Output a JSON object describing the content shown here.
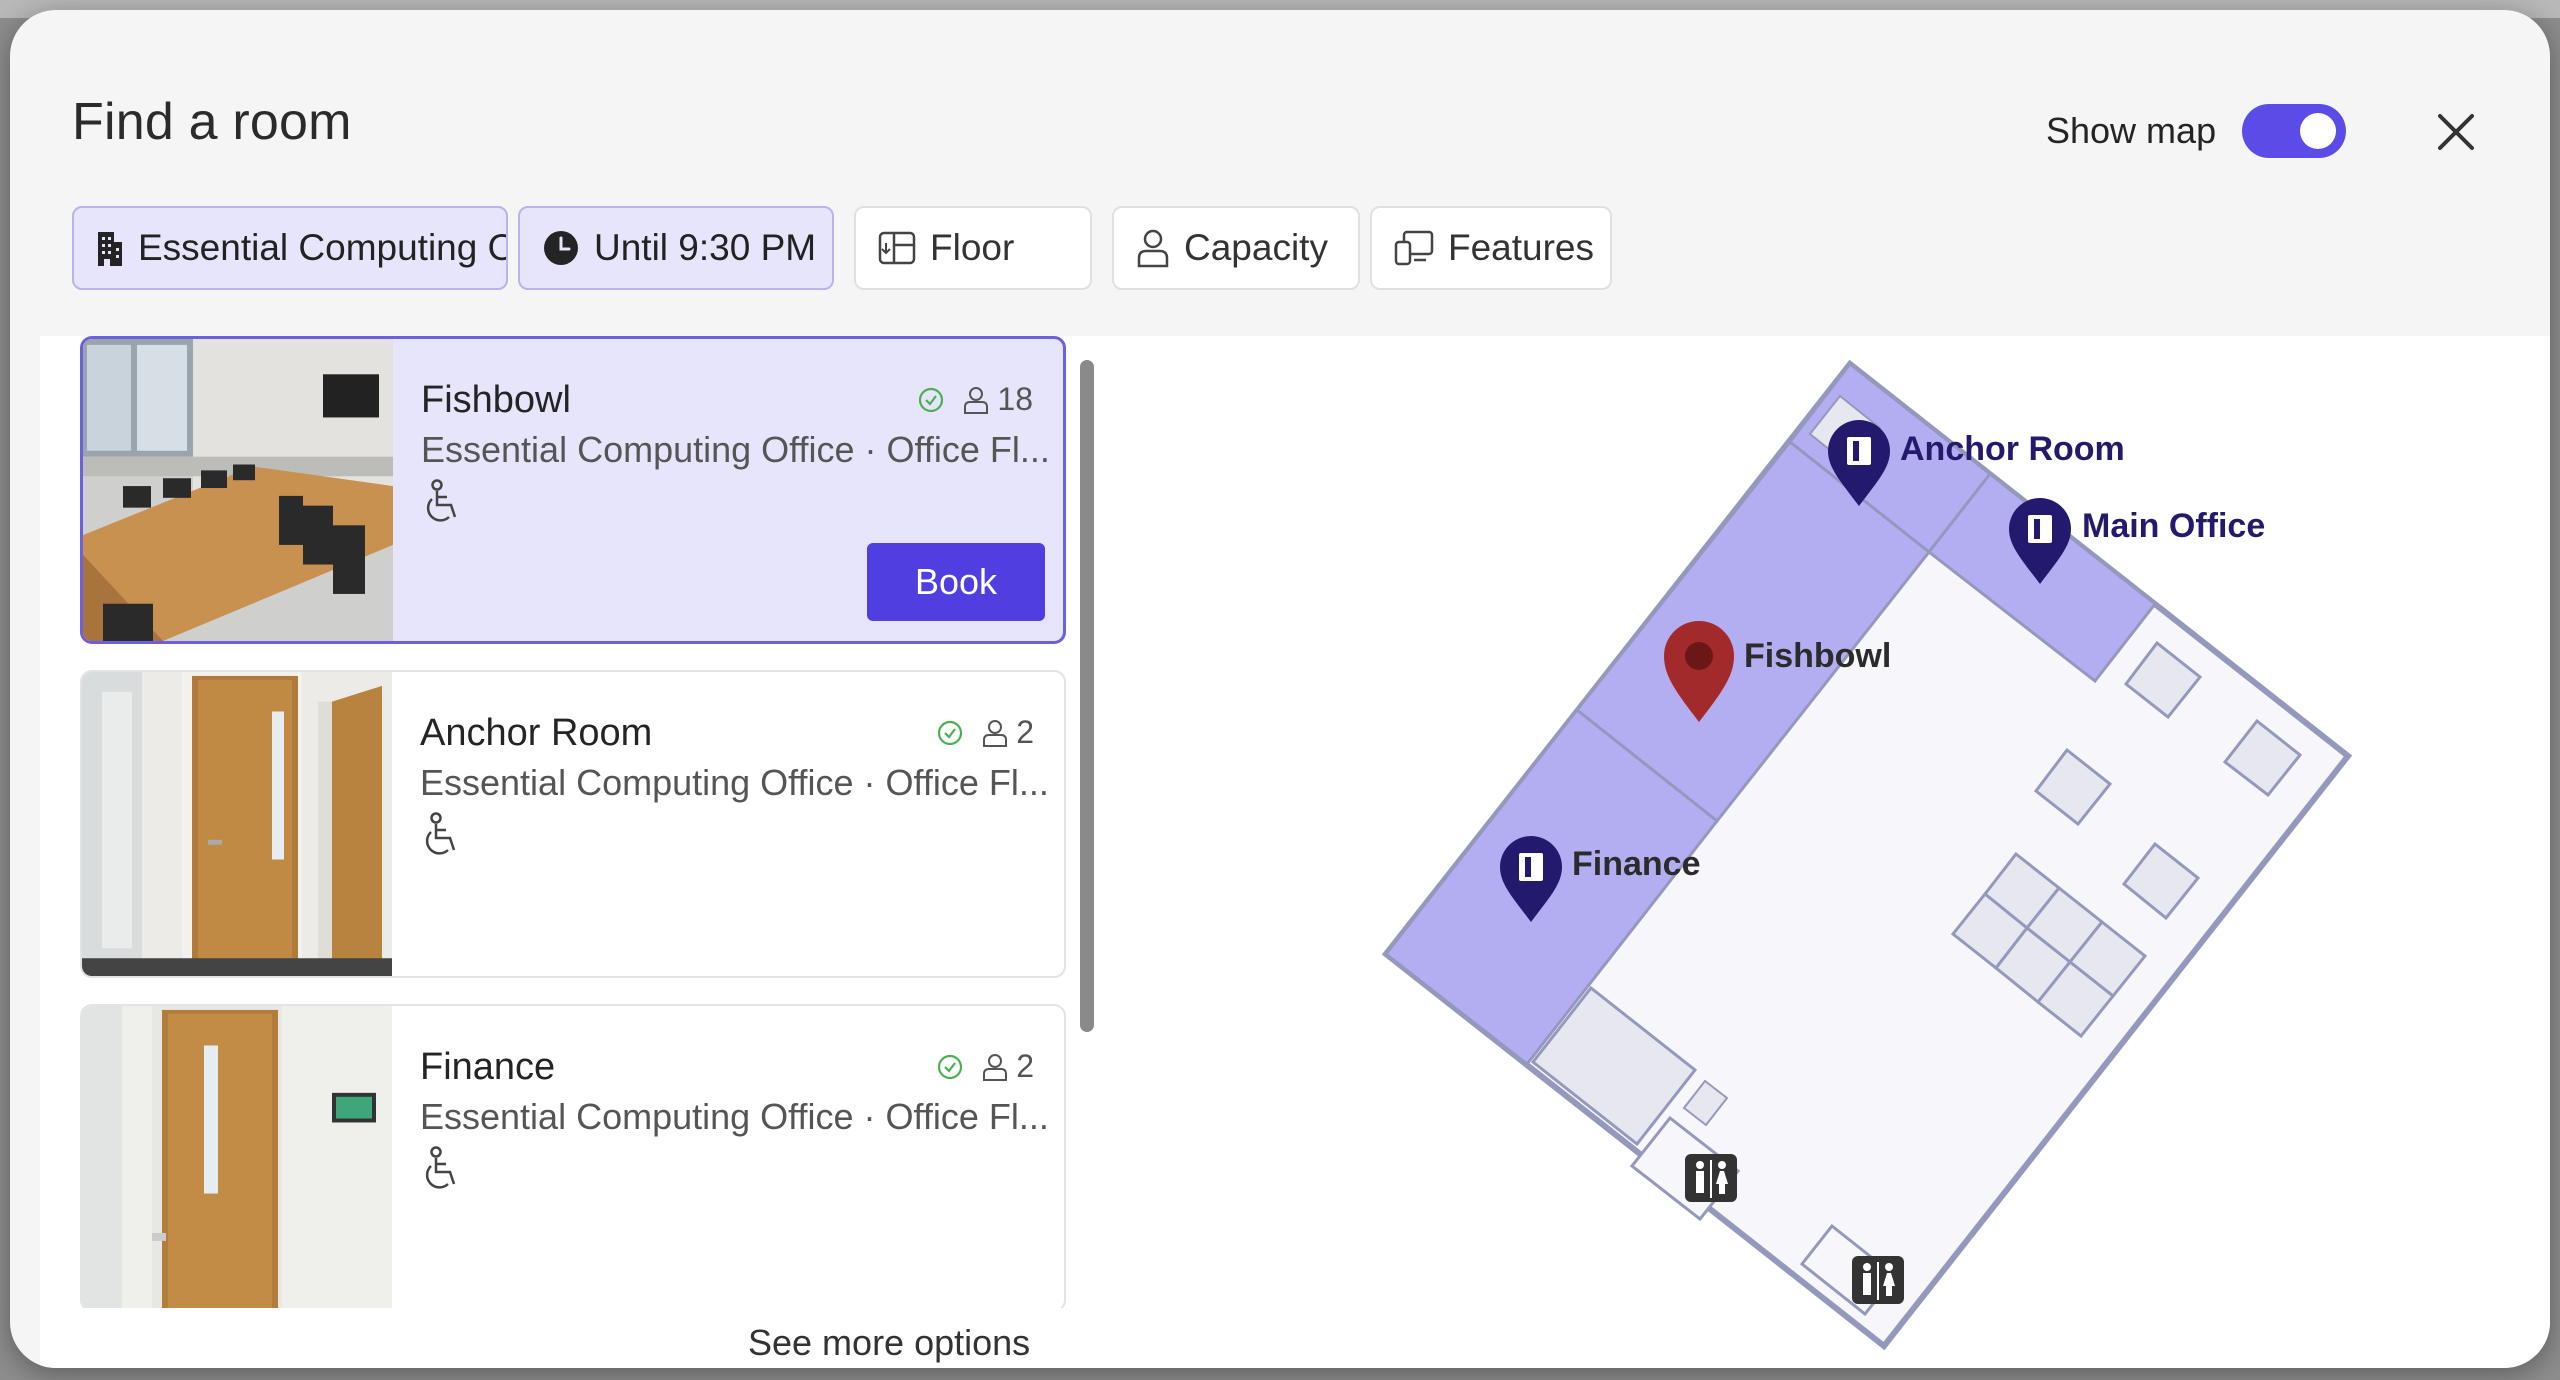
{
  "dialog": {
    "title": "Find a room",
    "show_map_label": "Show map",
    "show_map_on": true
  },
  "filters": {
    "building": "Essential Computing Office",
    "time": "Until 9:30 PM",
    "floor": "Floor",
    "capacity": "Capacity",
    "features": "Features"
  },
  "rooms": [
    {
      "name": "Fishbowl",
      "location": "Essential Computing Office · Office Fl...",
      "capacity": "18",
      "available": true,
      "accessible": true,
      "selected": true
    },
    {
      "name": "Anchor Room",
      "location": "Essential Computing Office · Office Fl...",
      "capacity": "2",
      "available": true,
      "accessible": true,
      "selected": false
    },
    {
      "name": "Finance",
      "location": "Essential Computing Office · Office Fl...",
      "capacity": "2",
      "available": true,
      "accessible": true,
      "selected": false
    }
  ],
  "book_label": "Book",
  "see_more": "See more options",
  "map": {
    "labels": {
      "anchor": "Anchor Room",
      "main": "Main Office",
      "fishbowl": "Fishbowl",
      "finance": "Finance"
    }
  },
  "colors": {
    "accent": "#4f3fe0",
    "selected_bg": "#e7e5fb",
    "room_fill": "#b3aef2",
    "pin_dark": "#231a6e",
    "pin_selected": "#a32a2a",
    "available": "#4caf50"
  }
}
